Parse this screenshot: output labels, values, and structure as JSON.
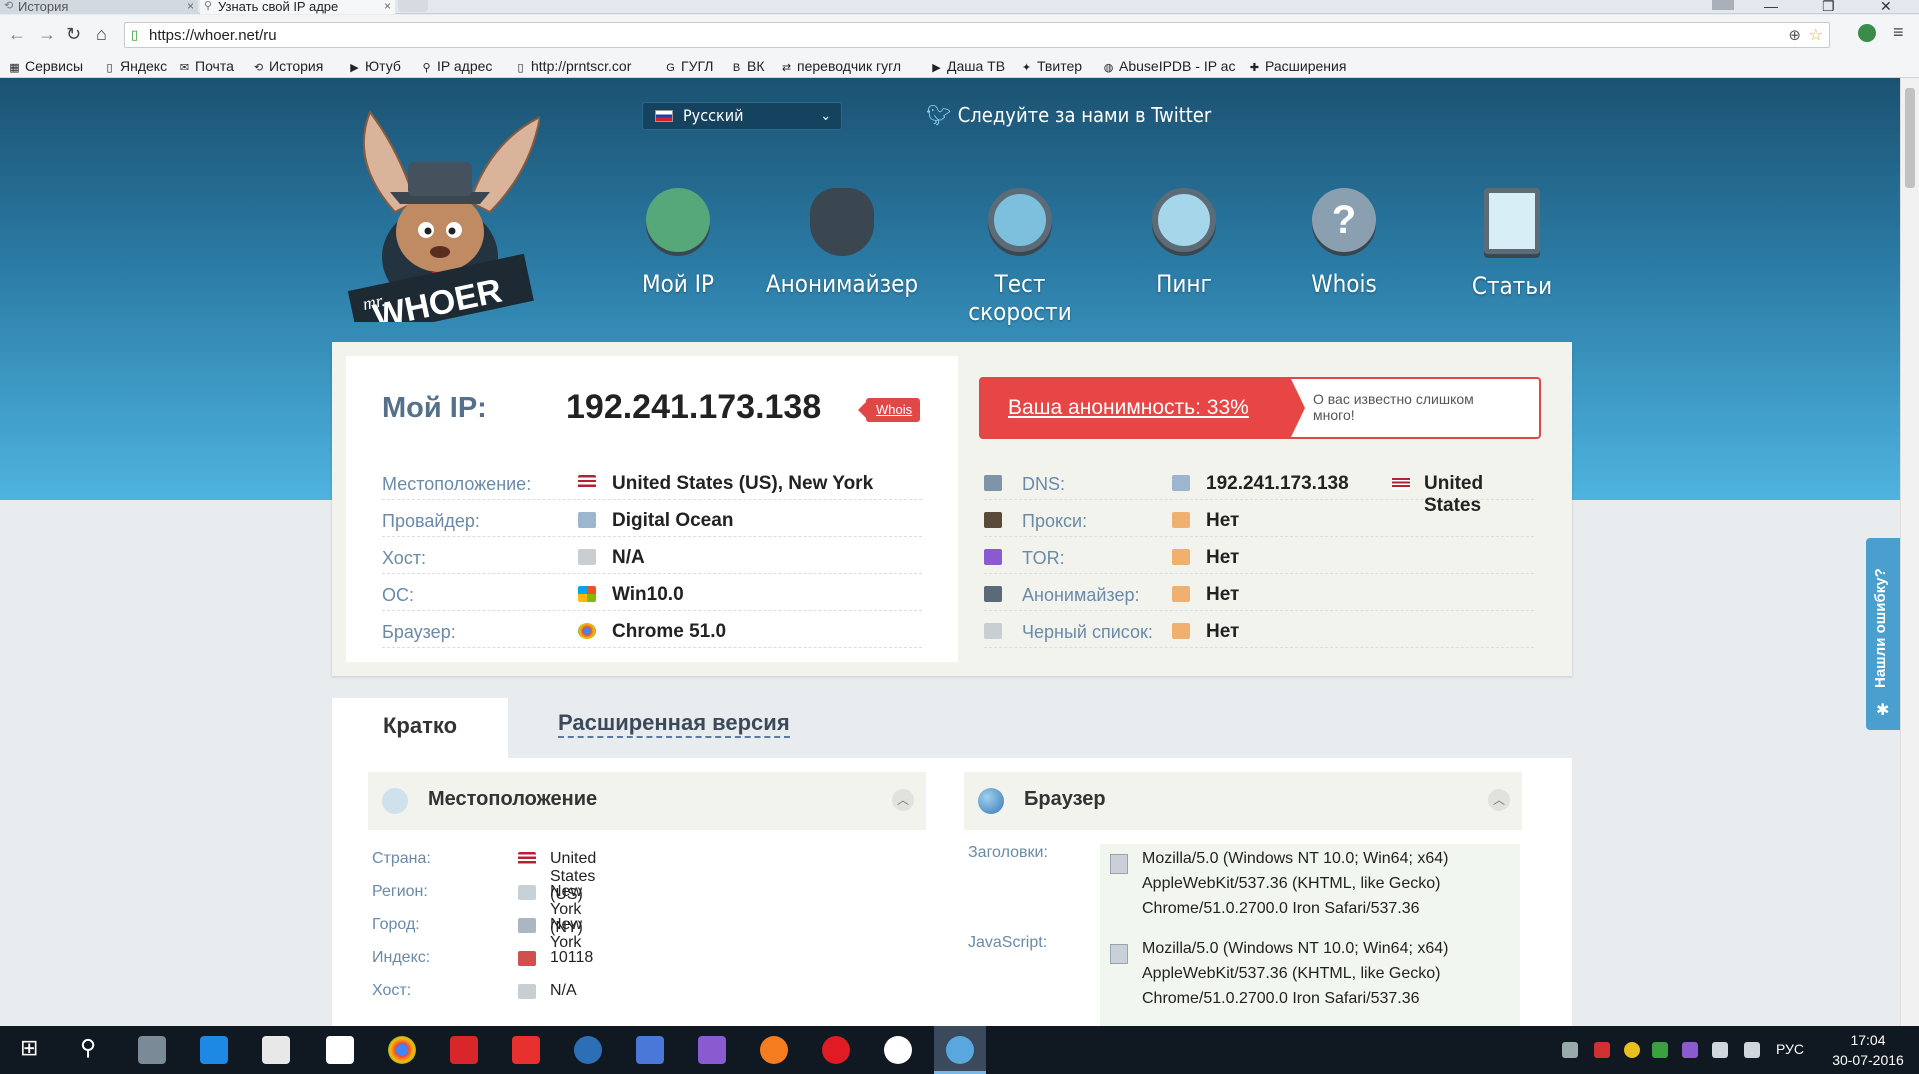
{
  "browser": {
    "tabs": [
      {
        "title": "История"
      },
      {
        "title": "Узнать свой IP адре"
      }
    ],
    "url": "https://whoer.net/ru",
    "bookmarks": [
      {
        "label": "Сервисы",
        "icon": "apps-icon"
      },
      {
        "label": "Яндекс",
        "icon": "page-icon"
      },
      {
        "label": "Почта",
        "icon": "mail-icon"
      },
      {
        "label": "История",
        "icon": "history-icon"
      },
      {
        "label": "Ютуб",
        "icon": "youtube-icon"
      },
      {
        "label": "IP адрес",
        "icon": "search-icon"
      },
      {
        "label": "http://prntscr.cor",
        "icon": "page-icon"
      },
      {
        "label": "ГУГЛ",
        "icon": "google-icon"
      },
      {
        "label": "ВК",
        "icon": "vk-icon"
      },
      {
        "label": "переводчик гугл",
        "icon": "translate-icon"
      },
      {
        "label": "Даша ТВ",
        "icon": "youtube-icon"
      },
      {
        "label": "Твитер",
        "icon": "twitter-icon"
      },
      {
        "label": "AbuseIPDB - IP ac",
        "icon": "abuseipdb-icon"
      },
      {
        "label": "Расширения",
        "icon": "puzzle-icon"
      }
    ]
  },
  "site": {
    "language": "Русский",
    "twitter": "Следуйте за нами в Twitter",
    "nav": [
      {
        "label": "Мой IP",
        "icon": "house-icon"
      },
      {
        "label": "Анонимайзер",
        "icon": "spy-hat-icon"
      },
      {
        "label": "Тест скорости",
        "icon": "speedometer-icon"
      },
      {
        "label": "Пинг",
        "icon": "radar-icon"
      },
      {
        "label": "Whois",
        "icon": "question-icon"
      },
      {
        "label": "Статьи",
        "icon": "document-icon"
      }
    ],
    "logo": {
      "small": "mr.",
      "big": "WHOER"
    }
  },
  "info": {
    "myip_label": "Мой IP:",
    "ip": "192.241.173.138",
    "whois_badge": "Whois",
    "anonymity": "Ваша анонимность: 33%",
    "anonymity_note": "О вас известно слишком много!",
    "left_rows": [
      {
        "label": "Местоположение:",
        "value": "United States (US), New York",
        "icon": "us-flag-icon"
      },
      {
        "label": "Провайдер:",
        "value": "Digital Ocean",
        "icon": "provider-icon"
      },
      {
        "label": "Хост:",
        "value": "N/A",
        "icon": "server-icon"
      },
      {
        "label": "ОС:",
        "value": "Win10.0",
        "icon": "windows-icon"
      },
      {
        "label": "Браузер:",
        "value": "Chrome 51.0",
        "icon": "chrome-icon"
      }
    ],
    "right_rows": [
      {
        "label": "DNS:",
        "value": "192.241.173.138",
        "country": "United States",
        "icon": "dns-icon",
        "value_icon": "network-icon"
      },
      {
        "label": "Прокси:",
        "value": "Нет",
        "icon": "spy-icon",
        "value_icon": "thumbs-up-icon"
      },
      {
        "label": "TOR:",
        "value": "Нет",
        "icon": "onion-icon",
        "value_icon": "thumbs-up-icon"
      },
      {
        "label": "Анонимайзер:",
        "value": "Нет",
        "icon": "glasses-icon",
        "value_icon": "thumbs-up-icon"
      },
      {
        "label": "Черный список:",
        "value": "Нет",
        "icon": "list-icon",
        "value_icon": "thumbs-up-icon"
      }
    ]
  },
  "details": {
    "tabs": [
      {
        "label": "Кратко"
      },
      {
        "label": "Расширенная версия"
      }
    ],
    "location": {
      "title": "Местоположение",
      "rows": [
        {
          "label": "Страна:",
          "value": "United States (US)",
          "icon": "us-flag-icon"
        },
        {
          "label": "Регион:",
          "value": "New York (NY)",
          "icon": "compass-icon"
        },
        {
          "label": "Город:",
          "value": "New York",
          "icon": "building-icon"
        },
        {
          "label": "Индекс:",
          "value": "10118",
          "icon": "mailbox-icon"
        },
        {
          "label": "Хост:",
          "value": "N/A",
          "icon": "server-icon"
        }
      ]
    },
    "browser": {
      "title": "Браузер",
      "headers_label": "Заголовки:",
      "headers_lines": [
        "Mozilla/5.0 (Windows NT 10.0; Win64; x64)",
        "AppleWebKit/537.36 (KHTML, like Gecko)",
        "Chrome/51.0.2700.0 Iron Safari/537.36"
      ],
      "js_label": "JavaScript:",
      "js_lines": [
        "Mozilla/5.0 (Windows NT 10.0; Win64; x64)",
        "AppleWebKit/537.36 (KHTML, like Gecko)",
        "Chrome/51.0.2700.0 Iron Safari/537.36"
      ]
    }
  },
  "feedback": {
    "label": "Нашли ошибку?"
  },
  "taskbar": {
    "lang": "РУС",
    "time": "17:04",
    "date": "30-07-2016",
    "apps": [
      "start-icon",
      "search-icon",
      "tool-icon",
      "edge-icon",
      "store-icon",
      "file-icon",
      "chrome-icon",
      "yandex-icon",
      "flash-icon",
      "browser-icon",
      "docs-icon",
      "feather-icon",
      "firefox-icon",
      "opera-icon",
      "yandex-browser-icon",
      "iron-icon"
    ]
  },
  "colors": {
    "accent_red": "#e84545",
    "label_blue": "#6a8aa8",
    "hero_top": "#1b5272",
    "hero_bottom": "#4eb4df"
  }
}
